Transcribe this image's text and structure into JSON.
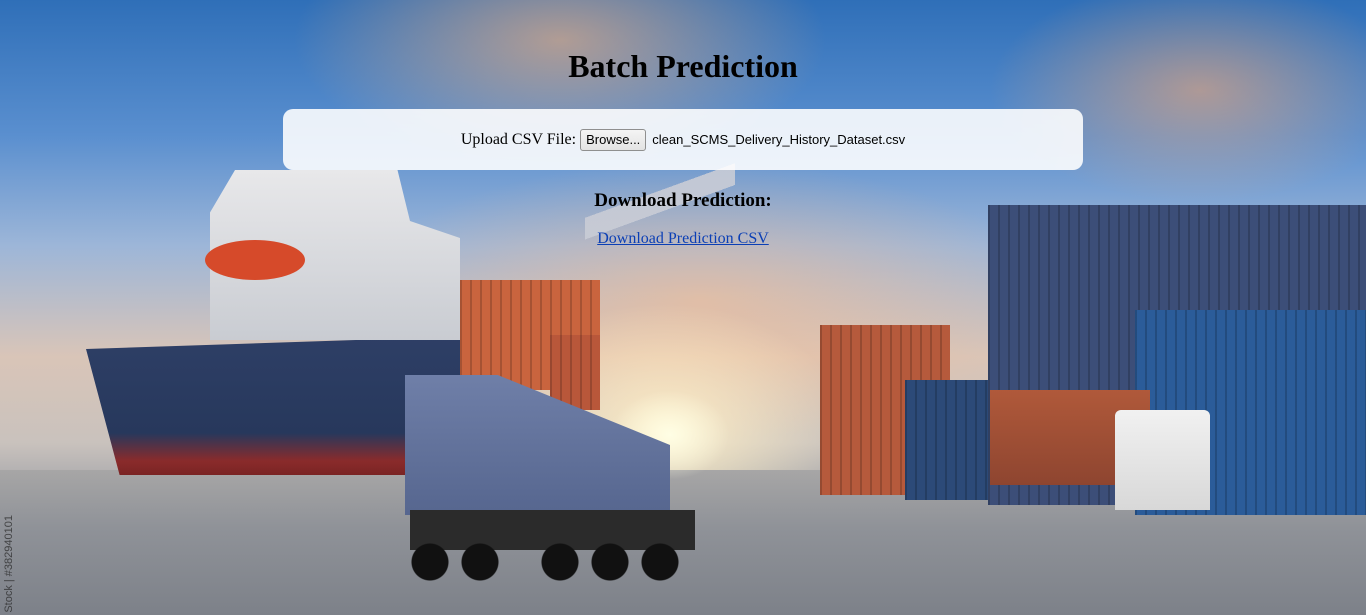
{
  "page": {
    "title": "Batch Prediction"
  },
  "upload": {
    "label": "Upload CSV File:",
    "browse_label": "Browse...",
    "file_name": "clean_SCMS_Delivery_History_Dataset.csv"
  },
  "download": {
    "heading": "Download Prediction:",
    "link_label": "Download Prediction CSV"
  },
  "background": {
    "watermark_text": "Stock | #382940101"
  },
  "colors": {
    "link": "#0b3fb5",
    "card_background": "rgba(255,255,255,0.88)"
  }
}
